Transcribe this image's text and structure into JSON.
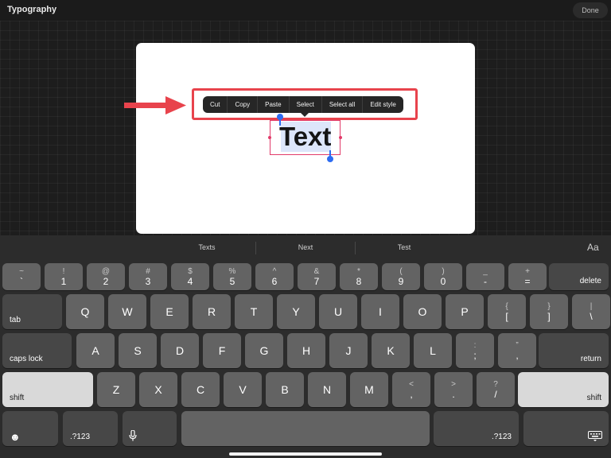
{
  "header": {
    "title": "Typography",
    "done_label": "Done"
  },
  "context_menu": {
    "items": [
      "Cut",
      "Copy",
      "Paste",
      "Select",
      "Select all",
      "Edit style"
    ]
  },
  "canvas": {
    "text_object": "Text"
  },
  "keyboard": {
    "suggestions": [
      "Texts",
      "Next",
      "Test"
    ],
    "format_label": "Aa",
    "row1": [
      {
        "top": "~",
        "bot": "`"
      },
      {
        "top": "!",
        "bot": "1"
      },
      {
        "top": "@",
        "bot": "2"
      },
      {
        "top": "#",
        "bot": "3"
      },
      {
        "top": "$",
        "bot": "4"
      },
      {
        "top": "%",
        "bot": "5"
      },
      {
        "top": "^",
        "bot": "6"
      },
      {
        "top": "&",
        "bot": "7"
      },
      {
        "top": "*",
        "bot": "8"
      },
      {
        "top": "(",
        "bot": "9"
      },
      {
        "top": ")",
        "bot": "0"
      },
      {
        "top": "_",
        "bot": "-"
      },
      {
        "top": "+",
        "bot": "="
      }
    ],
    "delete_label": "delete",
    "tab_label": "tab",
    "row2": [
      "Q",
      "W",
      "E",
      "R",
      "T",
      "Y",
      "U",
      "I",
      "O",
      "P"
    ],
    "row2_sym": [
      {
        "top": "{",
        "bot": "["
      },
      {
        "top": "}",
        "bot": "]"
      },
      {
        "top": "|",
        "bot": "\\"
      }
    ],
    "caps_label": "caps lock",
    "row3": [
      "A",
      "S",
      "D",
      "F",
      "G",
      "H",
      "J",
      "K",
      "L"
    ],
    "row3_sym": [
      {
        "top": ":",
        "bot": ";"
      },
      {
        "top": "”",
        "bot": ","
      }
    ],
    "return_label": "return",
    "shift_label": "shift",
    "row4": [
      "Z",
      "X",
      "C",
      "V",
      "B",
      "N",
      "M"
    ],
    "row4_sym": [
      {
        "top": "<",
        "bot": ","
      },
      {
        "top": ">",
        "bot": "."
      },
      {
        "top": "?",
        "bot": "/"
      }
    ],
    "emoji_icon": "☻",
    "num_label": ".?123",
    "mic_icon": "mic-icon",
    "keyboard_icon": "keyboard-dismiss-icon"
  },
  "colors": {
    "accent_blue": "#2d6cf2",
    "selection_pink": "#e23b6a",
    "annotation_red": "#e8434c"
  }
}
